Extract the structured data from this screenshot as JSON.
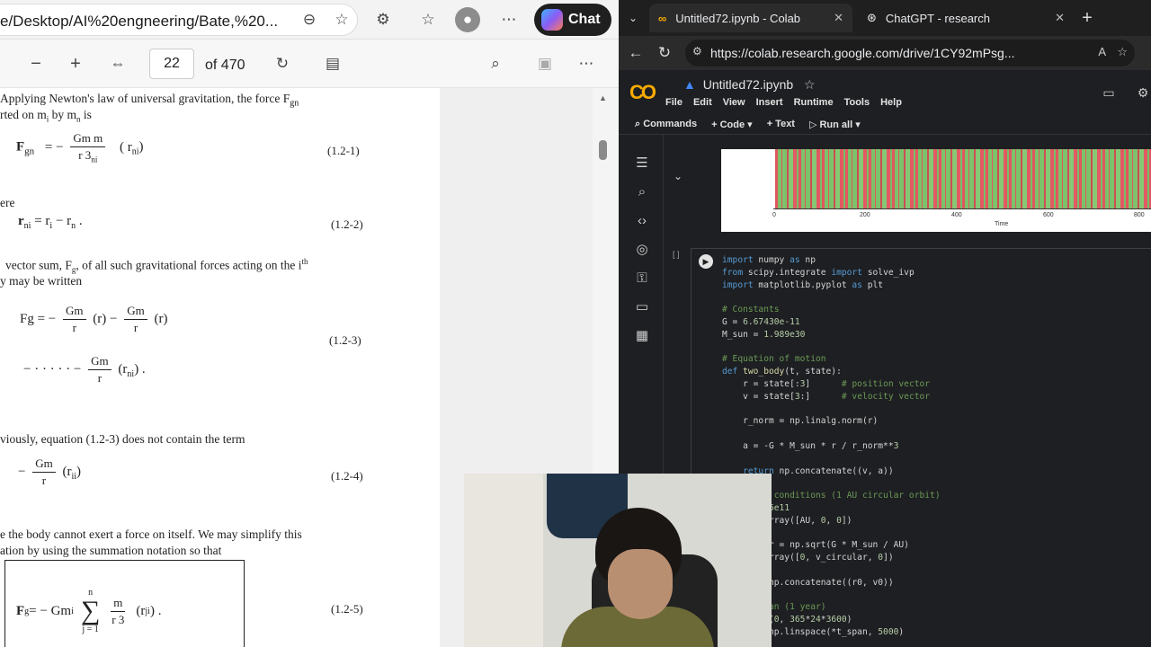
{
  "left_browser": {
    "url": "e/Desktop/AI%20engneering/Bate,%20...",
    "chat_label": "Chat",
    "pdf_toolbar": {
      "page": "22",
      "of": "of 470"
    }
  },
  "pdf": {
    "p1": "Applying  Newton's  law  of  universal  gravitation,  the  force  F",
    "p1b": "gn",
    "p2": "rted on  m",
    "p2b": "i",
    "p2c": "  by   m",
    "p2d": "n",
    "p2e": "  is",
    "eq1_lhs": "F",
    "eq1_sub": "gn",
    "eq1_eq": "=  −",
    "eq1_num": "Gm  m",
    "eq1_den": "r   3",
    "eq1_den_sub": "ni",
    "eq1_r": "( r",
    "eq1_r_sub": "ni",
    "eq1_close": ")",
    "eq1_no": "(1.2-1)",
    "p3": "ere",
    "eq2": "r",
    "eq2_sub": "ni",
    "eq2_rest": " =  r",
    "eq2_i": "i",
    "eq2_minus": "  −  r",
    "eq2_n": "n",
    "eq2_dot": "  .",
    "eq2_no": "(1.2-2)",
    "p4": "vector  sum,  F",
    "p4b": "g",
    "p4c": ",  of  all  such  gravitational  forces  acting  on  the  i",
    "p4d": "th",
    "p5": "y may be written",
    "eq3_lhs": "Fg = −",
    "eq3_n1": "Gm",
    "eq3_d1": "r",
    "eq3_t1": "(r",
    "eq3_mid": " −",
    "eq3_n2": "Gm",
    "eq3_d2": "r",
    "eq3_t2": "(r",
    "eq3_no": "(1.2-3)",
    "eq3b_dots": "− · · · · · −",
    "eq3b_n": "Gm",
    "eq3b_d": "r",
    "eq3b_t": "(r",
    "eq3b_sub": "ni",
    "eq3b_end": ") .",
    "p6": "viously, equation (1.2-3) does not contain the term",
    "eq4_minus": "−",
    "eq4_n": "Gm",
    "eq4_d": "r",
    "eq4_t": "(r",
    "eq4_sub": "ii",
    "eq4_end": ")",
    "eq4_no": "(1.2-4)",
    "p7": "e  the  body  cannot  exert  a  force  on  itself.  We  may  simplify  this",
    "p8": "ation by using the summation notation so that",
    "eq5_lhs": "F",
    "eq5_sub": "g",
    "eq5_rest": " = − Gm",
    "eq5_i": "i",
    "eq5_sum": "∑",
    "eq5_top": "n",
    "eq5_bot": "j = 1",
    "eq5_num": "m",
    "eq5_den": "r   3",
    "eq5_t": "(r",
    "eq5_tsub": "ji",
    "eq5_end": ")  .",
    "eq5_no": "(1.2-5)"
  },
  "right_browser": {
    "tabs": [
      {
        "label": "Untitled72.ipynb - Colab"
      },
      {
        "label": "ChatGPT - research"
      }
    ],
    "url": "https://colab.research.google.com/drive/1CY92mPsg...",
    "notebook_title": "Untitled72.ipynb",
    "menu": [
      "File",
      "Edit",
      "View",
      "Insert",
      "Runtime",
      "Tools",
      "Help"
    ],
    "toolbar": {
      "commands": "Commands",
      "code": "+ Code",
      "text": "+ Text",
      "run_all": "Run all"
    },
    "plot": {
      "ticks": [
        "0",
        "200",
        "400",
        "600",
        "800"
      ],
      "xlabel": "Time"
    },
    "cell_bracket": "[ ]"
  },
  "colors": {
    "colab_bg": "#1e1f22",
    "keyword": "#569cd6",
    "comment": "#6a9955",
    "bar_red": "#e0575f",
    "bar_green": "#7cc26a",
    "logo": "#f9ab00"
  }
}
